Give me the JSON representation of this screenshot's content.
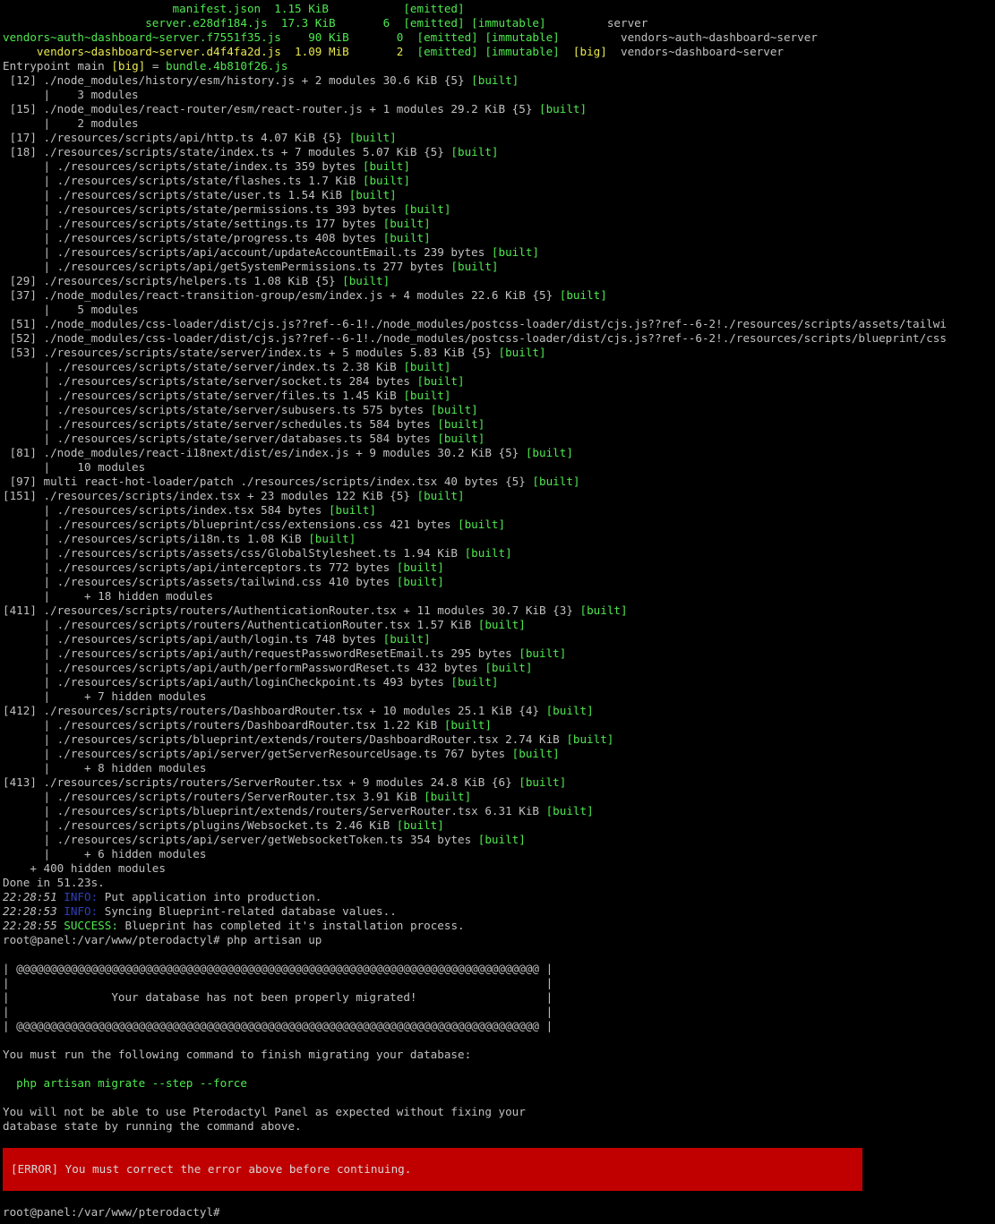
{
  "colors": {
    "background": "#000000",
    "text": "#c0c0c0",
    "green": "#4fe84f",
    "yellow": "#e8e84f",
    "blue": "#2f3fb8",
    "error_bg": "#c00000"
  },
  "lines": [
    [
      {
        "t": "                         manifest.json  1.15 KiB           ",
        "c": "g"
      },
      {
        "t": "[emitted]",
        "c": "g"
      }
    ],
    [
      {
        "t": "                     server.e28df184.js  17.3 KiB       6  ",
        "c": "g"
      },
      {
        "t": "[emitted] [immutable]",
        "c": "g"
      },
      {
        "t": "         server",
        "c": "w"
      }
    ],
    [
      {
        "t": "vendors~auth~dashboard~server.f7551f35.js    90 KiB       0  ",
        "c": "g"
      },
      {
        "t": "[emitted] [immutable]",
        "c": "g"
      },
      {
        "t": "         vendors~auth~dashboard~server",
        "c": "w"
      }
    ],
    [
      {
        "t": "     vendors~dashboard~server.d4f4fa2d.js  1.09 MiB       2  ",
        "c": "y"
      },
      {
        "t": "[emitted] [immutable]",
        "c": "g"
      },
      {
        "t": "  ",
        "c": "w"
      },
      {
        "t": "[big]",
        "c": "y"
      },
      {
        "t": "  vendors~dashboard~server",
        "c": "w"
      }
    ],
    [
      {
        "t": "Entrypoint main ",
        "c": "w"
      },
      {
        "t": "[big]",
        "c": "y"
      },
      {
        "t": " = ",
        "c": "w"
      },
      {
        "t": "bundle.4b810f26.js",
        "c": "g"
      }
    ],
    [
      {
        "t": " [12] ./node_modules/history/esm/history.js + 2 modules 30.6 KiB {5} ",
        "c": "w"
      },
      {
        "t": "[built]",
        "c": "g"
      }
    ],
    [
      {
        "t": "      |    3 modules",
        "c": "w"
      }
    ],
    [
      {
        "t": " [15] ./node_modules/react-router/esm/react-router.js + 1 modules 29.2 KiB {5} ",
        "c": "w"
      },
      {
        "t": "[built]",
        "c": "g"
      }
    ],
    [
      {
        "t": "      |    2 modules",
        "c": "w"
      }
    ],
    [
      {
        "t": " [17] ./resources/scripts/api/http.ts 4.07 KiB {5} ",
        "c": "w"
      },
      {
        "t": "[built]",
        "c": "g"
      }
    ],
    [
      {
        "t": " [18] ./resources/scripts/state/index.ts + 7 modules 5.07 KiB {5} ",
        "c": "w"
      },
      {
        "t": "[built]",
        "c": "g"
      }
    ],
    [
      {
        "t": "      | ./resources/scripts/state/index.ts 359 bytes ",
        "c": "w"
      },
      {
        "t": "[built]",
        "c": "g"
      }
    ],
    [
      {
        "t": "      | ./resources/scripts/state/flashes.ts 1.7 KiB ",
        "c": "w"
      },
      {
        "t": "[built]",
        "c": "g"
      }
    ],
    [
      {
        "t": "      | ./resources/scripts/state/user.ts 1.54 KiB ",
        "c": "w"
      },
      {
        "t": "[built]",
        "c": "g"
      }
    ],
    [
      {
        "t": "      | ./resources/scripts/state/permissions.ts 393 bytes ",
        "c": "w"
      },
      {
        "t": "[built]",
        "c": "g"
      }
    ],
    [
      {
        "t": "      | ./resources/scripts/state/settings.ts 177 bytes ",
        "c": "w"
      },
      {
        "t": "[built]",
        "c": "g"
      }
    ],
    [
      {
        "t": "      | ./resources/scripts/state/progress.ts 408 bytes ",
        "c": "w"
      },
      {
        "t": "[built]",
        "c": "g"
      }
    ],
    [
      {
        "t": "      | ./resources/scripts/api/account/updateAccountEmail.ts 239 bytes ",
        "c": "w"
      },
      {
        "t": "[built]",
        "c": "g"
      }
    ],
    [
      {
        "t": "      | ./resources/scripts/api/getSystemPermissions.ts 277 bytes ",
        "c": "w"
      },
      {
        "t": "[built]",
        "c": "g"
      }
    ],
    [
      {
        "t": " [29] ./resources/scripts/helpers.ts 1.08 KiB {5} ",
        "c": "w"
      },
      {
        "t": "[built]",
        "c": "g"
      }
    ],
    [
      {
        "t": " [37] ./node_modules/react-transition-group/esm/index.js + 4 modules 22.6 KiB {5} ",
        "c": "w"
      },
      {
        "t": "[built]",
        "c": "g"
      }
    ],
    [
      {
        "t": "      |    5 modules",
        "c": "w"
      }
    ],
    [
      {
        "t": " [51] ./node_modules/css-loader/dist/cjs.js??ref--6-1!./node_modules/postcss-loader/dist/cjs.js??ref--6-2!./resources/scripts/assets/tailwi",
        "c": "w"
      }
    ],
    [
      {
        "t": " [52] ./node_modules/css-loader/dist/cjs.js??ref--6-1!./node_modules/postcss-loader/dist/cjs.js??ref--6-2!./resources/scripts/blueprint/css",
        "c": "w"
      }
    ],
    [
      {
        "t": " [53] ./resources/scripts/state/server/index.ts + 5 modules 5.83 KiB {5} ",
        "c": "w"
      },
      {
        "t": "[built]",
        "c": "g"
      }
    ],
    [
      {
        "t": "      | ./resources/scripts/state/server/index.ts 2.38 KiB ",
        "c": "w"
      },
      {
        "t": "[built]",
        "c": "g"
      }
    ],
    [
      {
        "t": "      | ./resources/scripts/state/server/socket.ts 284 bytes ",
        "c": "w"
      },
      {
        "t": "[built]",
        "c": "g"
      }
    ],
    [
      {
        "t": "      | ./resources/scripts/state/server/files.ts 1.45 KiB ",
        "c": "w"
      },
      {
        "t": "[built]",
        "c": "g"
      }
    ],
    [
      {
        "t": "      | ./resources/scripts/state/server/subusers.ts 575 bytes ",
        "c": "w"
      },
      {
        "t": "[built]",
        "c": "g"
      }
    ],
    [
      {
        "t": "      | ./resources/scripts/state/server/schedules.ts 584 bytes ",
        "c": "w"
      },
      {
        "t": "[built]",
        "c": "g"
      }
    ],
    [
      {
        "t": "      | ./resources/scripts/state/server/databases.ts 584 bytes ",
        "c": "w"
      },
      {
        "t": "[built]",
        "c": "g"
      }
    ],
    [
      {
        "t": " [81] ./node_modules/react-i18next/dist/es/index.js + 9 modules 30.2 KiB {5} ",
        "c": "w"
      },
      {
        "t": "[built]",
        "c": "g"
      }
    ],
    [
      {
        "t": "      |    10 modules",
        "c": "w"
      }
    ],
    [
      {
        "t": " [97] multi react-hot-loader/patch ./resources/scripts/index.tsx 40 bytes {5} ",
        "c": "w"
      },
      {
        "t": "[built]",
        "c": "g"
      }
    ],
    [
      {
        "t": "[151] ./resources/scripts/index.tsx + 23 modules 122 KiB {5} ",
        "c": "w"
      },
      {
        "t": "[built]",
        "c": "g"
      }
    ],
    [
      {
        "t": "      | ./resources/scripts/index.tsx 584 bytes ",
        "c": "w"
      },
      {
        "t": "[built]",
        "c": "g"
      }
    ],
    [
      {
        "t": "      | ./resources/scripts/blueprint/css/extensions.css 421 bytes ",
        "c": "w"
      },
      {
        "t": "[built]",
        "c": "g"
      }
    ],
    [
      {
        "t": "      | ./resources/scripts/i18n.ts 1.08 KiB ",
        "c": "w"
      },
      {
        "t": "[built]",
        "c": "g"
      }
    ],
    [
      {
        "t": "      | ./resources/scripts/assets/css/GlobalStylesheet.ts 1.94 KiB ",
        "c": "w"
      },
      {
        "t": "[built]",
        "c": "g"
      }
    ],
    [
      {
        "t": "      | ./resources/scripts/api/interceptors.ts 772 bytes ",
        "c": "w"
      },
      {
        "t": "[built]",
        "c": "g"
      }
    ],
    [
      {
        "t": "      | ./resources/scripts/assets/tailwind.css 410 bytes ",
        "c": "w"
      },
      {
        "t": "[built]",
        "c": "g"
      }
    ],
    [
      {
        "t": "      |     + 18 hidden modules",
        "c": "w"
      }
    ],
    [
      {
        "t": "[411] ./resources/scripts/routers/AuthenticationRouter.tsx + 11 modules 30.7 KiB {3} ",
        "c": "w"
      },
      {
        "t": "[built]",
        "c": "g"
      }
    ],
    [
      {
        "t": "      | ./resources/scripts/routers/AuthenticationRouter.tsx 1.57 KiB ",
        "c": "w"
      },
      {
        "t": "[built]",
        "c": "g"
      }
    ],
    [
      {
        "t": "      | ./resources/scripts/api/auth/login.ts 748 bytes ",
        "c": "w"
      },
      {
        "t": "[built]",
        "c": "g"
      }
    ],
    [
      {
        "t": "      | ./resources/scripts/api/auth/requestPasswordResetEmail.ts 295 bytes ",
        "c": "w"
      },
      {
        "t": "[built]",
        "c": "g"
      }
    ],
    [
      {
        "t": "      | ./resources/scripts/api/auth/performPasswordReset.ts 432 bytes ",
        "c": "w"
      },
      {
        "t": "[built]",
        "c": "g"
      }
    ],
    [
      {
        "t": "      | ./resources/scripts/api/auth/loginCheckpoint.ts 493 bytes ",
        "c": "w"
      },
      {
        "t": "[built]",
        "c": "g"
      }
    ],
    [
      {
        "t": "      |     + 7 hidden modules",
        "c": "w"
      }
    ],
    [
      {
        "t": "[412] ./resources/scripts/routers/DashboardRouter.tsx + 10 modules 25.1 KiB {4} ",
        "c": "w"
      },
      {
        "t": "[built]",
        "c": "g"
      }
    ],
    [
      {
        "t": "      | ./resources/scripts/routers/DashboardRouter.tsx 1.22 KiB ",
        "c": "w"
      },
      {
        "t": "[built]",
        "c": "g"
      }
    ],
    [
      {
        "t": "      | ./resources/scripts/blueprint/extends/routers/DashboardRouter.tsx 2.74 KiB ",
        "c": "w"
      },
      {
        "t": "[built]",
        "c": "g"
      }
    ],
    [
      {
        "t": "      | ./resources/scripts/api/server/getServerResourceUsage.ts 767 bytes ",
        "c": "w"
      },
      {
        "t": "[built]",
        "c": "g"
      }
    ],
    [
      {
        "t": "      |     + 8 hidden modules",
        "c": "w"
      }
    ],
    [
      {
        "t": "[413] ./resources/scripts/routers/ServerRouter.tsx + 9 modules 24.8 KiB {6} ",
        "c": "w"
      },
      {
        "t": "[built]",
        "c": "g"
      }
    ],
    [
      {
        "t": "      | ./resources/scripts/routers/ServerRouter.tsx 3.91 KiB ",
        "c": "w"
      },
      {
        "t": "[built]",
        "c": "g"
      }
    ],
    [
      {
        "t": "      | ./resources/scripts/blueprint/extends/routers/ServerRouter.tsx 6.31 KiB ",
        "c": "w"
      },
      {
        "t": "[built]",
        "c": "g"
      }
    ],
    [
      {
        "t": "      | ./resources/scripts/plugins/Websocket.ts 2.46 KiB ",
        "c": "w"
      },
      {
        "t": "[built]",
        "c": "g"
      }
    ],
    [
      {
        "t": "      | ./resources/scripts/api/server/getWebsocketToken.ts 354 bytes ",
        "c": "w"
      },
      {
        "t": "[built]",
        "c": "g"
      }
    ],
    [
      {
        "t": "      |     + 6 hidden modules",
        "c": "w"
      }
    ],
    [
      {
        "t": "    + 400 hidden modules",
        "c": "w"
      }
    ],
    [
      {
        "t": "Done in 51.23s.",
        "c": "w"
      }
    ],
    [
      {
        "t": "22:28:51 ",
        "c": "tm"
      },
      {
        "t": "INFO:",
        "c": "bl"
      },
      {
        "t": " Put application into production.",
        "c": "w"
      }
    ],
    [
      {
        "t": "22:28:53 ",
        "c": "tm"
      },
      {
        "t": "INFO:",
        "c": "bl"
      },
      {
        "t": " Syncing Blueprint-related database values..",
        "c": "w"
      }
    ],
    [
      {
        "t": "22:28:55 ",
        "c": "tm"
      },
      {
        "t": "SUCCESS:",
        "c": "g"
      },
      {
        "t": " Blueprint has completed it's installation process.",
        "c": "w"
      }
    ],
    [
      {
        "t": "root@panel:/var/www/pterodactyl# php artisan up",
        "c": "w"
      }
    ],
    [
      {
        "t": "",
        "c": "w"
      }
    ],
    [
      {
        "t": "| @@@@@@@@@@@@@@@@@@@@@@@@@@@@@@@@@@@@@@@@@@@@@@@@@@@@@@@@@@@@@@@@@@@@@@@@@@@@@ |",
        "c": "w"
      }
    ],
    [
      {
        "t": "|                                                                               |",
        "c": "w"
      }
    ],
    [
      {
        "t": "|               Your database has not been properly migrated!                   |",
        "c": "w"
      }
    ],
    [
      {
        "t": "|                                                                               |",
        "c": "w"
      }
    ],
    [
      {
        "t": "| @@@@@@@@@@@@@@@@@@@@@@@@@@@@@@@@@@@@@@@@@@@@@@@@@@@@@@@@@@@@@@@@@@@@@@@@@@@@@ |",
        "c": "w"
      }
    ],
    [
      {
        "t": "",
        "c": "w"
      }
    ],
    [
      {
        "t": "You must run the following command to finish migrating your database:",
        "c": "w"
      }
    ],
    [
      {
        "t": "",
        "c": "w"
      }
    ],
    [
      {
        "t": "  php artisan migrate --step --force",
        "c": "g"
      }
    ],
    [
      {
        "t": "",
        "c": "w"
      }
    ],
    [
      {
        "t": "You will not be able to use Pterodactyl Panel as expected without fixing your",
        "c": "w"
      }
    ],
    [
      {
        "t": "database state by running the command above.",
        "c": "w"
      }
    ]
  ],
  "error_message": "[ERROR] You must correct the error above before continuing.",
  "final_prompt": "root@panel:/var/www/pterodactyl#"
}
